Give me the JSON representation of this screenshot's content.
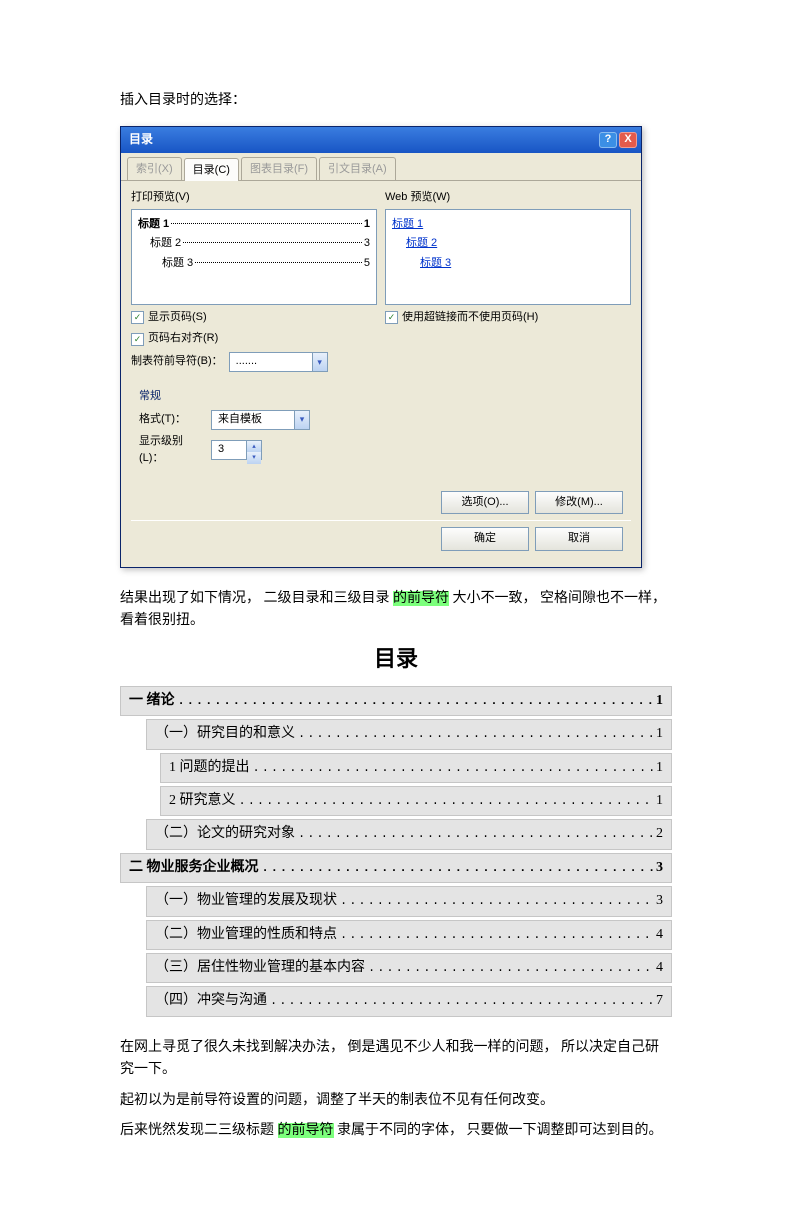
{
  "intro": "插入目录时的选择：",
  "dialog": {
    "title": "目录",
    "help": "?",
    "close": "X",
    "tabs": {
      "index": "索引(X)",
      "toc": "目录(C)",
      "figures": "图表目录(F)",
      "citations": "引文目录(A)"
    },
    "print_preview_label": "打印预览(V)",
    "web_preview_label": "Web 预览(W)",
    "print_preview_lines": [
      {
        "text": "标题 1",
        "page": "1",
        "indent": 0,
        "bold": true
      },
      {
        "text": "标题 2",
        "page": "3",
        "indent": 1,
        "bold": false
      },
      {
        "text": "标题 3",
        "page": "5",
        "indent": 2,
        "bold": false
      }
    ],
    "web_preview_lines": [
      {
        "text": "标题 1",
        "indent": 0
      },
      {
        "text": "标题 2",
        "indent": 1
      },
      {
        "text": "标题 3",
        "indent": 2
      }
    ],
    "show_page_numbers": "显示页码(S)",
    "right_align_pages": "页码右对齐(R)",
    "tab_leader_label": "制表符前导符(B)：",
    "tab_leader_value": ".......",
    "hyperlinks_instead": "使用超链接而不使用页码(H)",
    "general_title": "常规",
    "format_label": "格式(T)：",
    "format_value": "来自模板",
    "levels_label": "显示级别(L)：",
    "levels_value": "3",
    "btn_options": "选项(O)...",
    "btn_modify": "修改(M)...",
    "btn_ok": "确定",
    "btn_cancel": "取消"
  },
  "result_intro": {
    "p1a": "结果出现了如下情况，  二级目录和三级目录 ",
    "hl1": "的前导符",
    "p1b": " 大小不一致，  空格间隙也不一样，看着很别扭。"
  },
  "toc": {
    "title": "目录",
    "rows": [
      {
        "level": 1,
        "label": "一  绪论",
        "page": "1"
      },
      {
        "level": 2,
        "label": "（一）研究目的和意义",
        "page": "1"
      },
      {
        "level": 3,
        "label": "1  问题的提出",
        "page": "1"
      },
      {
        "level": 3,
        "label": "2  研究意义",
        "page": "1"
      },
      {
        "level": 2,
        "label": "（二）论文的研究对象",
        "page": "2"
      },
      {
        "level": 1,
        "label": "二  物业服务企业概况",
        "page": "3"
      },
      {
        "level": 2,
        "label": "（一）物业管理的发展及现状",
        "page": "3"
      },
      {
        "level": 2,
        "label": "（二）物业管理的性质和特点",
        "page": "4"
      },
      {
        "level": 2,
        "label": "（三）居住性物业管理的基本内容",
        "page": "4"
      },
      {
        "level": 2,
        "label": "（四）冲突与沟通",
        "page": "7"
      }
    ]
  },
  "body": {
    "p2": "在网上寻觅了很久未找到解决办法，   倒是遇见不少人和我一样的问题，   所以决定自己研究一下。",
    "p3": "起初以为是前导符设置的问题，调整了半天的制表位不见有任何改变。",
    "p4a": "后来恍然发现二三级标题 ",
    "hl2": "的前导符",
    "p4b": " 隶属于不同的字体，  只要做一下调整即可达到目的。"
  }
}
